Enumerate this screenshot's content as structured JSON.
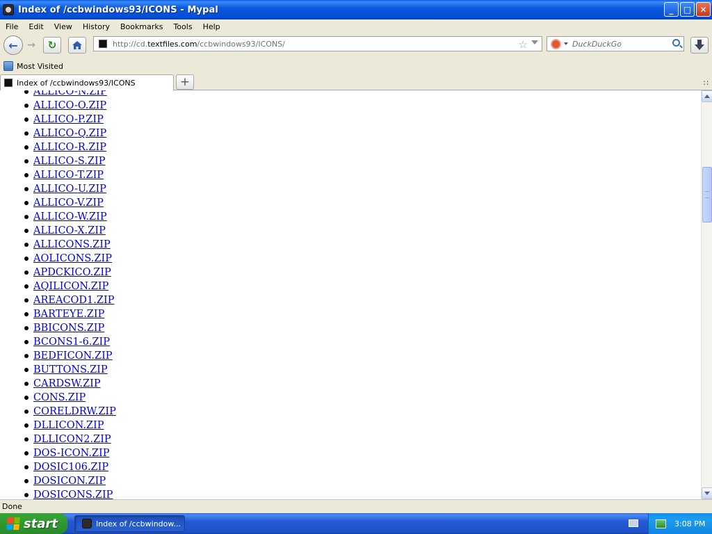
{
  "window": {
    "title": "Index of /ccbwindows93/ICONS - Mypal",
    "buttons": {
      "minimize": "_",
      "maximize": "□",
      "close": "✕"
    }
  },
  "menu": [
    {
      "label": "File"
    },
    {
      "label": "Edit"
    },
    {
      "label": "View"
    },
    {
      "label": "History"
    },
    {
      "label": "Bookmarks"
    },
    {
      "label": "Tools"
    },
    {
      "label": "Help"
    }
  ],
  "toolbar": {
    "url_prefix": "http://cd.",
    "url_domain": "textfiles.com",
    "url_path": "/ccbwindows93/ICONS/",
    "search_placeholder": "DuckDuckGo"
  },
  "bookmarks": {
    "most_visited": "Most Visited"
  },
  "tabs": [
    {
      "label": "Index of /ccbwindows93/ICONS"
    }
  ],
  "files": [
    "ALLICO-N.ZIP",
    "ALLICO-O.ZIP",
    "ALLICO-P.ZIP",
    "ALLICO-Q.ZIP",
    "ALLICO-R.ZIP",
    "ALLICO-S.ZIP",
    "ALLICO-T.ZIP",
    "ALLICO-U.ZIP",
    "ALLICO-V.ZIP",
    "ALLICO-W.ZIP",
    "ALLICO-X.ZIP",
    "ALLICONS.ZIP",
    "AOLICONS.ZIP",
    "APDCKICO.ZIP",
    "AQILICON.ZIP",
    "AREACOD1.ZIP",
    "BARTEYE.ZIP",
    "BBICONS.ZIP",
    "BCONS1-6.ZIP",
    "BEDFICON.ZIP",
    "BUTTONS.ZIP",
    "CARDSW.ZIP",
    "CONS.ZIP",
    "CORELDRW.ZIP",
    "DLLICON.ZIP",
    "DLLICON2.ZIP",
    "DOS-ICON.ZIP",
    "DOSIC106.ZIP",
    "DOSICON.ZIP",
    "DOSICONS.ZIP"
  ],
  "status": {
    "text": "Done"
  },
  "taskbar": {
    "start_label": "start",
    "task_label": "Index of /ccbwindow...",
    "clock": "3:08 PM"
  },
  "colors": {
    "link": "#0000ee",
    "titlebar": "#0a5fe6",
    "taskbar": "#245edb",
    "start": "#3aa43a"
  }
}
